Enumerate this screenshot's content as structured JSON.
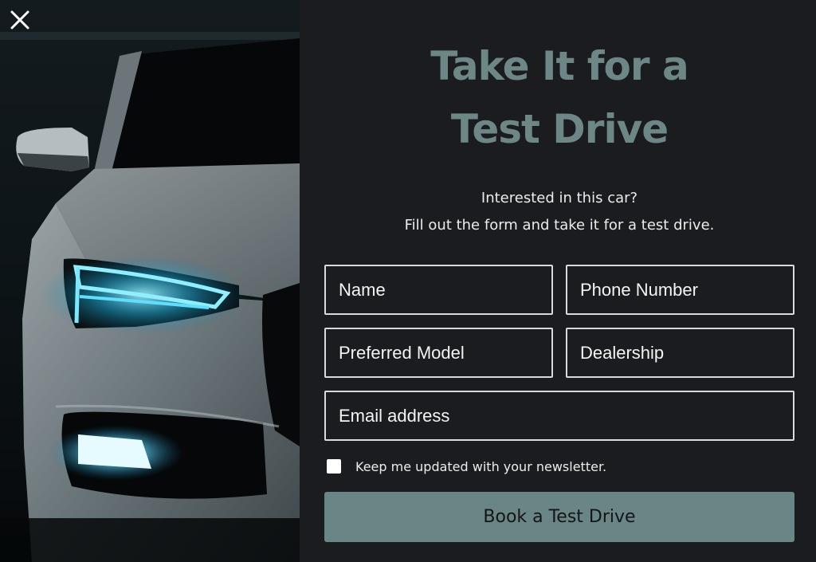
{
  "modal": {
    "close_icon": "close-icon",
    "image": "car-headlight-photo"
  },
  "content": {
    "headline_line1": "Take It for a",
    "headline_line2": "Test Drive",
    "intro_line1": "Interested in this car?",
    "intro_line2": "Fill out the form and take it for a test drive."
  },
  "form": {
    "name_placeholder": "Name",
    "phone_placeholder": "Phone Number",
    "model_placeholder": "Preferred Model",
    "dealership_placeholder": "Dealership",
    "email_placeholder": "Email address",
    "newsletter_label": "Keep me updated with your newsletter.",
    "newsletter_checked": false,
    "submit_label": "Book a Test Drive"
  },
  "colors": {
    "accent": "#6a8585",
    "background": "#1b1c1f",
    "headline": "#6d8787",
    "headlight": "#3fd2ff"
  }
}
